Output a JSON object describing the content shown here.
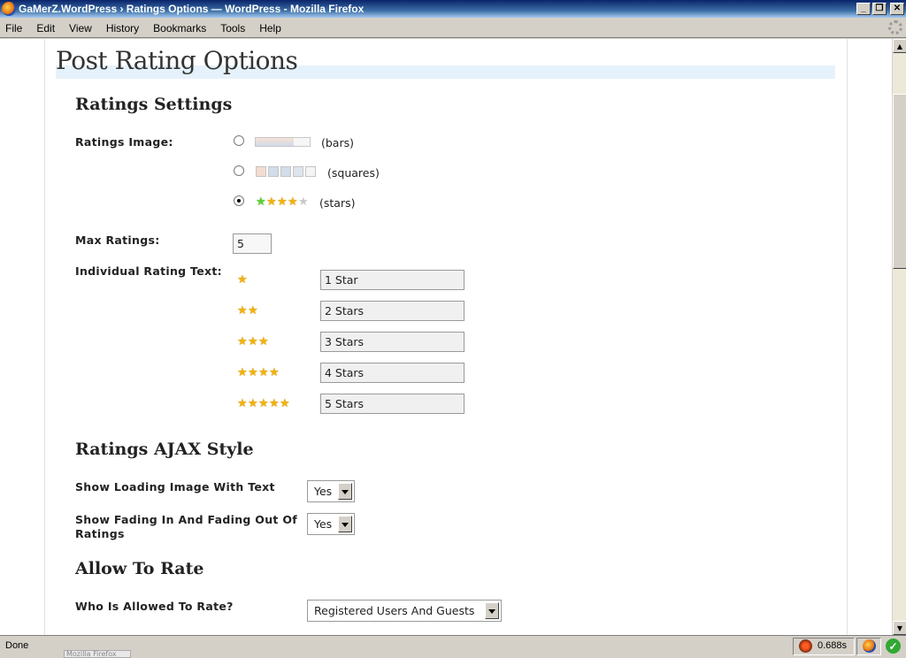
{
  "window": {
    "title": "GaMerZ.WordPress › Ratings Options — WordPress - Mozilla Firefox"
  },
  "menu": [
    "File",
    "Edit",
    "View",
    "History",
    "Bookmarks",
    "Tools",
    "Help"
  ],
  "page": {
    "title": "Post Rating Options",
    "ratings_settings": {
      "heading": "Ratings Settings",
      "image_label": "Ratings Image:",
      "image_options": [
        {
          "text": "(bars)",
          "checked": false
        },
        {
          "text": "(squares)",
          "checked": false
        },
        {
          "text": "(stars)",
          "checked": true
        }
      ],
      "max_label": "Max Ratings:",
      "max_value": "5",
      "rating_text_label": "Individual Rating Text:",
      "rating_texts": [
        "1 Star",
        "2 Stars",
        "3 Stars",
        "4 Stars",
        "5 Stars"
      ]
    },
    "ajax_style": {
      "heading": "Ratings AJAX Style",
      "loading_label": "Show Loading Image With Text",
      "loading_value": "Yes",
      "fading_label_1": "Show Fading In And Fading Out Of",
      "fading_label_2": "Ratings",
      "fading_value": "Yes"
    },
    "allow_rate": {
      "heading": "Allow To Rate",
      "who_label": "Who Is Allowed To Rate?",
      "who_value": "Registered Users And Guests"
    }
  },
  "status": {
    "text": "Done",
    "timing": "0.688s",
    "taskbar_ghost": "Mozilla Firefox"
  },
  "colors": {
    "title_band": "#e6f2fb",
    "star": "#f2b20c",
    "star_green": "#5fd23a"
  }
}
